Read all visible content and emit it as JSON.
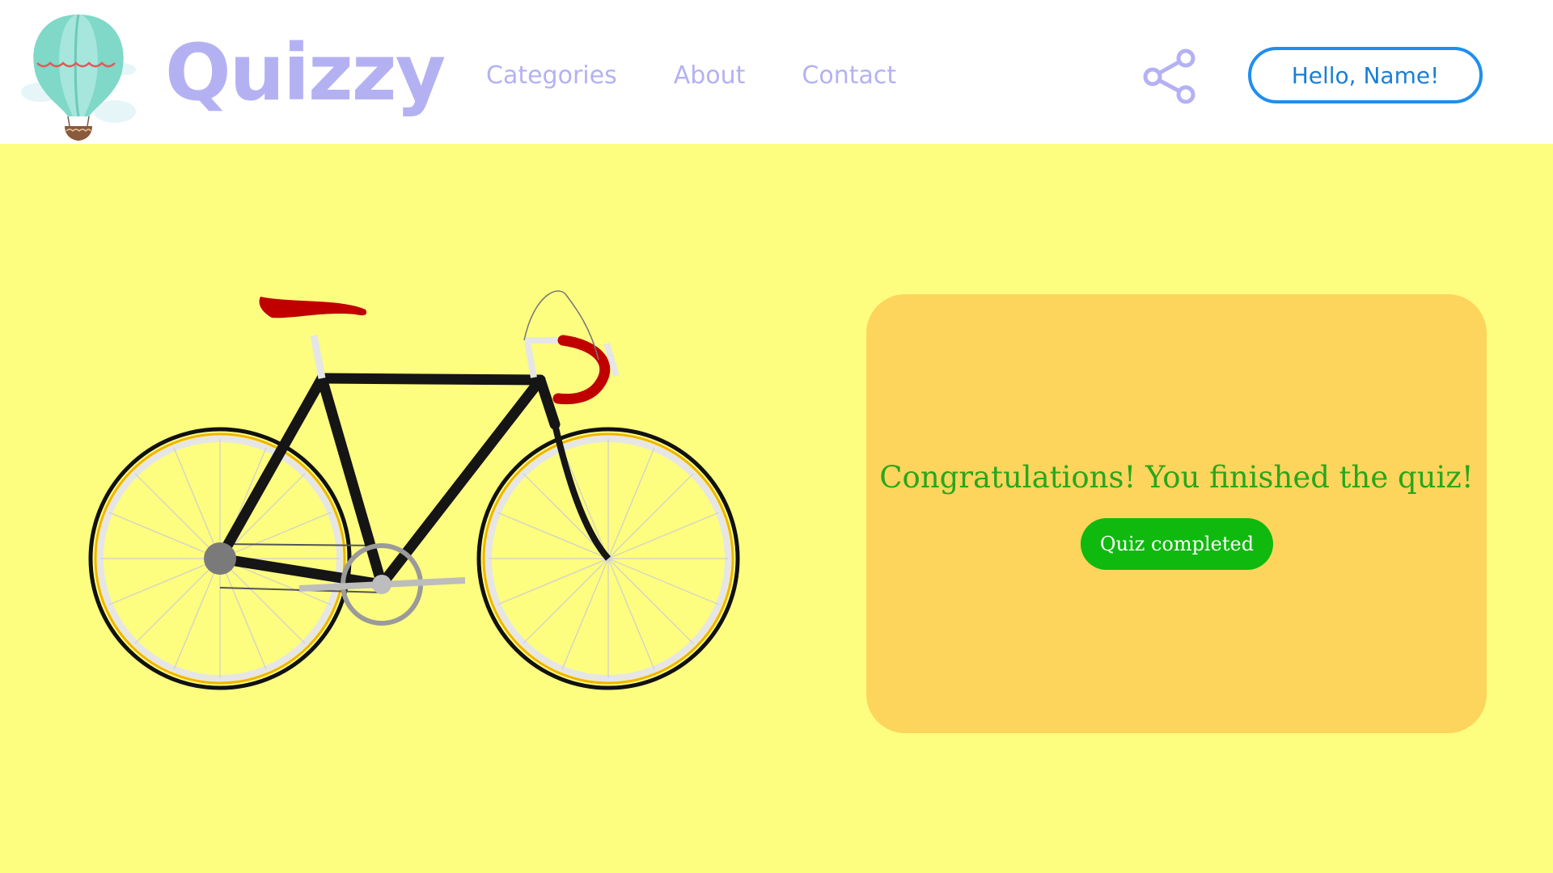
{
  "header": {
    "brand": "Quizzy",
    "nav": [
      "Categories",
      "About",
      "Contact"
    ],
    "greeting_button": "Hello, Name!",
    "icons": {
      "logo": "hot-air-balloon-icon",
      "share": "share-icon"
    }
  },
  "main": {
    "illustration": "bicycle-illustration",
    "result_card": {
      "message": "Congratulations! You finished the quiz!",
      "status_button": "Quiz completed"
    }
  },
  "colors": {
    "page_background": "#fdfd80",
    "header_background": "#ffffff",
    "brand": "#b4b1f3",
    "nav_text": "#b4b1f3",
    "greeting_border": "#1f8ef1",
    "card_background": "#fdd55c",
    "message_text": "#29a61c",
    "status_button": "#10b90e"
  }
}
